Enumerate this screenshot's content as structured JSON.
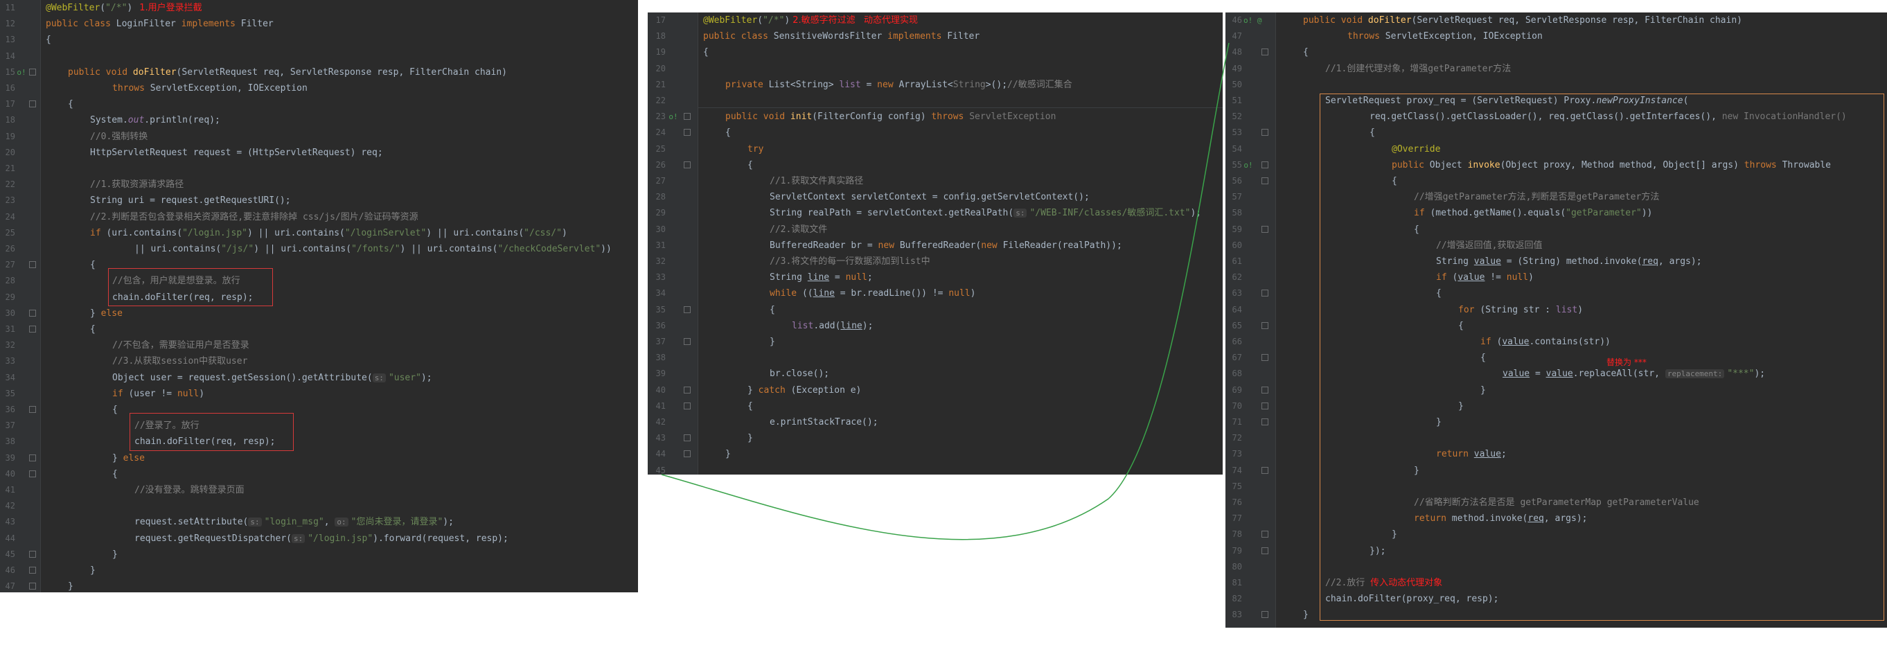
{
  "panel_a": {
    "lines": [
      {
        "n": "11",
        "mark": "",
        "fold": false,
        "indent": 0,
        "html": "<span class='ann'>@WebFilter</span>(<span class='str'>\"/*\"</span>)<span class='red-note'>1.用户登录拦截</span>"
      },
      {
        "n": "12",
        "mark": "",
        "fold": false,
        "indent": 0,
        "html": "<span class='kw'>public class </span>LoginFilter <span class='kw'>implements </span>Filter"
      },
      {
        "n": "13",
        "mark": "",
        "fold": false,
        "indent": 0,
        "html": "{"
      },
      {
        "n": "14",
        "mark": "",
        "fold": false,
        "indent": 0,
        "html": ""
      },
      {
        "n": "15",
        "mark": "o!",
        "fold": true,
        "indent": 1,
        "html": "<span class='kw'>public void </span><span class='fn'>doFilter</span>(ServletRequest req, ServletResponse resp, FilterChain chain)"
      },
      {
        "n": "16",
        "mark": "",
        "fold": false,
        "indent": 3,
        "html": "<span class='kw'>throws </span>ServletException, IOException"
      },
      {
        "n": "17",
        "mark": "",
        "fold": true,
        "indent": 1,
        "html": "{"
      },
      {
        "n": "18",
        "mark": "",
        "fold": false,
        "indent": 2,
        "html": "System.<span class='it'>out</span>.println(req);"
      },
      {
        "n": "19",
        "mark": "",
        "fold": false,
        "indent": 2,
        "html": "<span class='cmt'>//0.强制转换</span>"
      },
      {
        "n": "20",
        "mark": "",
        "fold": false,
        "indent": 2,
        "html": "HttpServletRequest request = (HttpServletRequest) req;"
      },
      {
        "n": "21",
        "mark": "",
        "fold": false,
        "indent": 0,
        "html": ""
      },
      {
        "n": "22",
        "mark": "",
        "fold": false,
        "indent": 2,
        "html": "<span class='cmt'>//1.获取资源请求路径</span>"
      },
      {
        "n": "23",
        "mark": "",
        "fold": false,
        "indent": 2,
        "html": "String uri = request.getRequestURI();"
      },
      {
        "n": "24",
        "mark": "",
        "fold": false,
        "indent": 2,
        "html": "<span class='cmt'>//2.判断是否包含登录相关资源路径,要注意排除掉 css/js/图片/验证码等资源</span>"
      },
      {
        "n": "25",
        "mark": "",
        "fold": false,
        "indent": 2,
        "html": "<span class='kw'>if </span>(uri.contains(<span class='str'>\"/login.jsp\"</span>) || uri.contains(<span class='str'>\"/loginServlet\"</span>) || uri.contains(<span class='str'>\"/css/\"</span>)"
      },
      {
        "n": "26",
        "mark": "",
        "fold": false,
        "indent": 4,
        "html": "|| uri.contains(<span class='str'>\"/js/\"</span>) || uri.contains(<span class='str'>\"/fonts/\"</span>) || uri.contains(<span class='str'>\"/checkCodeServlet\"</span>))"
      },
      {
        "n": "27",
        "mark": "",
        "fold": true,
        "indent": 2,
        "html": "{"
      },
      {
        "n": "28",
        "mark": "",
        "fold": false,
        "indent": 3,
        "html": "<span class='cmt'>//包含，用户就是想登录。放行</span>"
      },
      {
        "n": "29",
        "mark": "",
        "fold": false,
        "indent": 3,
        "html": "chain.doFilter(req, resp);"
      },
      {
        "n": "30",
        "mark": "",
        "fold": true,
        "indent": 2,
        "html": "} <span class='kw'>else</span>"
      },
      {
        "n": "31",
        "mark": "",
        "fold": true,
        "indent": 2,
        "html": "{"
      },
      {
        "n": "32",
        "mark": "",
        "fold": false,
        "indent": 3,
        "html": "<span class='cmt'>//不包含，需要验证用户是否登录</span>"
      },
      {
        "n": "33",
        "mark": "",
        "fold": false,
        "indent": 3,
        "html": "<span class='cmt'>//3.从获取session中获取user</span>"
      },
      {
        "n": "34",
        "mark": "",
        "fold": false,
        "indent": 3,
        "html": "Object user = request.getSession().getAttribute(<span class='hint'>s:</span><span class='str'>\"user\"</span>);"
      },
      {
        "n": "35",
        "mark": "",
        "fold": false,
        "indent": 3,
        "html": "<span class='kw'>if </span>(user != <span class='kw'>null</span>)"
      },
      {
        "n": "36",
        "mark": "",
        "fold": true,
        "indent": 3,
        "html": "{"
      },
      {
        "n": "37",
        "mark": "",
        "fold": false,
        "indent": 4,
        "html": "<span class='cmt'>//登录了。放行</span>"
      },
      {
        "n": "38",
        "mark": "",
        "fold": false,
        "indent": 4,
        "html": "chain.doFilter(req, resp);"
      },
      {
        "n": "39",
        "mark": "",
        "fold": true,
        "indent": 3,
        "html": "} <span class='kw'>else</span>"
      },
      {
        "n": "40",
        "mark": "",
        "fold": true,
        "indent": 3,
        "html": "{"
      },
      {
        "n": "41",
        "mark": "",
        "fold": false,
        "indent": 4,
        "html": "<span class='cmt'>//没有登录。跳转登录页面</span>"
      },
      {
        "n": "42",
        "mark": "",
        "fold": false,
        "indent": 0,
        "html": ""
      },
      {
        "n": "43",
        "mark": "",
        "fold": false,
        "indent": 4,
        "html": "request.setAttribute(<span class='hint'>s:</span><span class='str'>\"login_msg\"</span>, <span class='hint'>o:</span><span class='str'>\"您尚未登录，请登录\"</span>);"
      },
      {
        "n": "44",
        "mark": "",
        "fold": false,
        "indent": 4,
        "html": "request.getRequestDispatcher(<span class='hint'>s:</span><span class='str'>\"/login.jsp\"</span>).forward(request, resp);"
      },
      {
        "n": "45",
        "mark": "",
        "fold": true,
        "indent": 3,
        "html": "}"
      },
      {
        "n": "46",
        "mark": "",
        "fold": true,
        "indent": 2,
        "html": "}"
      },
      {
        "n": "47",
        "mark": "",
        "fold": true,
        "indent": 1,
        "html": "}"
      }
    ]
  },
  "panel_b": {
    "lines": [
      {
        "n": "17",
        "mark": "",
        "fold": false,
        "indent": 0,
        "html": "<span class='ann'>@WebFilter</span>(<span class='str'>\"/*\"</span>)<span class='red-note' style='margin-left:4px'>2.敏感字符过滤&nbsp;&nbsp;&nbsp;动态代理实现</span>"
      },
      {
        "n": "18",
        "mark": "",
        "fold": false,
        "indent": 0,
        "html": "<span class='kw'>public class </span>SensitiveWordsFilter <span class='kw'>implements </span>Filter"
      },
      {
        "n": "19",
        "mark": "",
        "fold": false,
        "indent": 0,
        "html": "{"
      },
      {
        "n": "20",
        "mark": "",
        "fold": false,
        "indent": 0,
        "html": ""
      },
      {
        "n": "21",
        "mark": "",
        "fold": false,
        "indent": 1,
        "html": "<span class='kw'>private </span>List&lt;String&gt; <span class='fld'>list </span>= <span class='kw'>new </span>ArrayList&lt;<span class='gray'>String</span>&gt;();<span class='cmt'>//敏感词汇集合</span>"
      },
      {
        "n": "22",
        "mark": "",
        "fold": false,
        "indent": 0,
        "html": ""
      },
      {
        "n": "23",
        "mark": "o!",
        "fold": true,
        "indent": 1,
        "html": "<span class='kw'>public void </span><span class='fn'>init</span>(FilterConfig config) <span class='kw'>throws </span><span class='gray'>ServletException</span>"
      },
      {
        "n": "24",
        "mark": "",
        "fold": true,
        "indent": 1,
        "html": "{"
      },
      {
        "n": "25",
        "mark": "",
        "fold": false,
        "indent": 2,
        "html": "<span class='kw'>try</span>"
      },
      {
        "n": "26",
        "mark": "",
        "fold": true,
        "indent": 2,
        "html": "{"
      },
      {
        "n": "27",
        "mark": "",
        "fold": false,
        "indent": 3,
        "html": "<span class='cmt'>//1.获取文件真实路径</span>"
      },
      {
        "n": "28",
        "mark": "",
        "fold": false,
        "indent": 3,
        "html": "ServletContext servletContext = config.getServletContext();"
      },
      {
        "n": "29",
        "mark": "",
        "fold": false,
        "indent": 3,
        "html": "String realPath = servletContext.getRealPath(<span class='hint'>s:</span><span class='str'>\"/WEB-INF/classes/敏感词汇.txt\"</span>);"
      },
      {
        "n": "30",
        "mark": "",
        "fold": false,
        "indent": 3,
        "html": "<span class='cmt'>//2.读取文件</span>"
      },
      {
        "n": "31",
        "mark": "",
        "fold": false,
        "indent": 3,
        "html": "BufferedReader br = <span class='kw'>new </span>BufferedReader(<span class='kw'>new </span>FileReader(realPath));"
      },
      {
        "n": "32",
        "mark": "",
        "fold": false,
        "indent": 3,
        "html": "<span class='cmt'>//3.将文件的每一行数据添加到list中</span>"
      },
      {
        "n": "33",
        "mark": "",
        "fold": false,
        "indent": 3,
        "html": "String <span class='und'>line</span> = <span class='kw'>null</span>;"
      },
      {
        "n": "34",
        "mark": "",
        "fold": false,
        "indent": 3,
        "html": "<span class='kw'>while </span>((<span class='und'>line</span> = br.readLine()) != <span class='kw'>null</span>)"
      },
      {
        "n": "35",
        "mark": "",
        "fold": true,
        "indent": 3,
        "html": "{"
      },
      {
        "n": "36",
        "mark": "",
        "fold": false,
        "indent": 4,
        "html": "<span class='fld'>list</span>.add(<span class='und'>line</span>);"
      },
      {
        "n": "37",
        "mark": "",
        "fold": true,
        "indent": 3,
        "html": "}"
      },
      {
        "n": "38",
        "mark": "",
        "fold": false,
        "indent": 0,
        "html": ""
      },
      {
        "n": "39",
        "mark": "",
        "fold": false,
        "indent": 3,
        "html": "br.close();"
      },
      {
        "n": "40",
        "mark": "",
        "fold": true,
        "indent": 2,
        "html": "} <span class='kw'>catch </span>(Exception e)"
      },
      {
        "n": "41",
        "mark": "",
        "fold": true,
        "indent": 2,
        "html": "{"
      },
      {
        "n": "42",
        "mark": "",
        "fold": false,
        "indent": 3,
        "html": "e.printStackTrace();"
      },
      {
        "n": "43",
        "mark": "",
        "fold": true,
        "indent": 2,
        "html": "}"
      },
      {
        "n": "44",
        "mark": "",
        "fold": true,
        "indent": 1,
        "html": "}"
      },
      {
        "n": "45",
        "mark": "",
        "fold": false,
        "indent": 0,
        "html": ""
      }
    ]
  },
  "panel_c": {
    "lines": [
      {
        "n": "46",
        "mark": "o! @",
        "fold": false,
        "indent": 1,
        "html": "<span class='kw'>public void </span><span class='fn'>doFilter</span>(ServletRequest req, ServletResponse resp, FilterChain chain)"
      },
      {
        "n": "47",
        "mark": "",
        "fold": false,
        "indent": 3,
        "html": "<span class='kw'>throws </span>ServletException, IOException"
      },
      {
        "n": "48",
        "mark": "",
        "fold": true,
        "indent": 1,
        "html": "{"
      },
      {
        "n": "49",
        "mark": "",
        "fold": false,
        "indent": 2,
        "html": "<span class='cmt'>//1.创建代理对象，增强getParameter方法</span>"
      },
      {
        "n": "50",
        "mark": "",
        "fold": false,
        "indent": 0,
        "html": ""
      },
      {
        "n": "51",
        "mark": "",
        "fold": false,
        "indent": 2,
        "html": "ServletRequest proxy_req = (ServletRequest) Proxy.<span class='it' style='color:#a9b7c6'>newProxyInstance</span>("
      },
      {
        "n": "52",
        "mark": "",
        "fold": false,
        "indent": 4,
        "html": "req.getClass().getClassLoader(), req.getClass().getInterfaces(), <span class='gray'>new InvocationHandler()</span>"
      },
      {
        "n": "53",
        "mark": "",
        "fold": true,
        "indent": 4,
        "html": "{"
      },
      {
        "n": "54",
        "mark": "",
        "fold": false,
        "indent": 5,
        "html": "<span class='ann'>@Override</span>"
      },
      {
        "n": "55",
        "mark": "o!",
        "fold": true,
        "indent": 5,
        "html": "<span class='kw'>public </span>Object <span class='fn'>invoke</span>(Object proxy, Method method, Object[] args) <span class='kw'>throws </span>Throwable"
      },
      {
        "n": "56",
        "mark": "",
        "fold": true,
        "indent": 5,
        "html": "{"
      },
      {
        "n": "57",
        "mark": "",
        "fold": false,
        "indent": 6,
        "html": "<span class='cmt'>//增强getParameter方法,判断是否是getParameter方法</span>"
      },
      {
        "n": "58",
        "mark": "",
        "fold": false,
        "indent": 6,
        "html": "<span class='kw'>if </span>(method.getName().equals(<span class='str'>\"getParameter\"</span>))"
      },
      {
        "n": "59",
        "mark": "",
        "fold": true,
        "indent": 6,
        "html": "{"
      },
      {
        "n": "60",
        "mark": "",
        "fold": false,
        "indent": 7,
        "html": "<span class='cmt'>//增强返回值,获取返回值</span>"
      },
      {
        "n": "61",
        "mark": "",
        "fold": false,
        "indent": 7,
        "html": "String <span class='und'>value</span> = (String) method.invoke(<span class='und'>req</span>, args);"
      },
      {
        "n": "62",
        "mark": "",
        "fold": false,
        "indent": 7,
        "html": "<span class='kw'>if </span>(<span class='und'>value</span> != <span class='kw'>null</span>)"
      },
      {
        "n": "63",
        "mark": "",
        "fold": true,
        "indent": 7,
        "html": "{"
      },
      {
        "n": "64",
        "mark": "",
        "fold": false,
        "indent": 8,
        "html": "<span class='kw'>for </span>(String str : <span class='fld'>list</span>)"
      },
      {
        "n": "65",
        "mark": "",
        "fold": true,
        "indent": 8,
        "html": "{"
      },
      {
        "n": "66",
        "mark": "",
        "fold": false,
        "indent": 9,
        "html": "<span class='kw'>if </span>(<span class='und'>value</span>.contains(str))"
      },
      {
        "n": "67",
        "mark": "",
        "fold": true,
        "indent": 9,
        "html": "{"
      },
      {
        "n": "68",
        "mark": "",
        "fold": false,
        "indent": 10,
        "html": "<span class='und'>value</span> = <span class='und'>value</span>.replaceAll(str, <span class='hint'>replacement:</span><span class='str'>\"***\"</span>);"
      },
      {
        "n": "69",
        "mark": "",
        "fold": true,
        "indent": 9,
        "html": "}"
      },
      {
        "n": "70",
        "mark": "",
        "fold": true,
        "indent": 8,
        "html": "}"
      },
      {
        "n": "71",
        "mark": "",
        "fold": true,
        "indent": 7,
        "html": "}"
      },
      {
        "n": "72",
        "mark": "",
        "fold": false,
        "indent": 0,
        "html": ""
      },
      {
        "n": "73",
        "mark": "",
        "fold": false,
        "indent": 7,
        "html": "<span class='kw'>return </span><span class='und'>value</span>;"
      },
      {
        "n": "74",
        "mark": "",
        "fold": true,
        "indent": 6,
        "html": "}"
      },
      {
        "n": "75",
        "mark": "",
        "fold": false,
        "indent": 0,
        "html": ""
      },
      {
        "n": "76",
        "mark": "",
        "fold": false,
        "indent": 6,
        "html": "<span class='cmt'>//省略判断方法名是否是 getParameterMap getParameterValue</span>"
      },
      {
        "n": "77",
        "mark": "",
        "fold": false,
        "indent": 6,
        "html": "<span class='kw'>return </span>method.invoke(<span class='und'>req</span>, args);"
      },
      {
        "n": "78",
        "mark": "",
        "fold": true,
        "indent": 5,
        "html": "}"
      },
      {
        "n": "79",
        "mark": "",
        "fold": true,
        "indent": 4,
        "html": "});"
      },
      {
        "n": "80",
        "mark": "",
        "fold": false,
        "indent": 0,
        "html": ""
      },
      {
        "n": "81",
        "mark": "",
        "fold": false,
        "indent": 2,
        "html": "<span class='cmt'>//2.放行 </span><span class='red-note' style='margin-left:0'>传入动态代理对象</span>"
      },
      {
        "n": "82",
        "mark": "",
        "fold": false,
        "indent": 2,
        "html": "chain.doFilter(proxy_req, resp);"
      },
      {
        "n": "83",
        "mark": "",
        "fold": true,
        "indent": 1,
        "html": "}"
      }
    ]
  },
  "notes": {
    "replace_label": "替换为 ***"
  }
}
